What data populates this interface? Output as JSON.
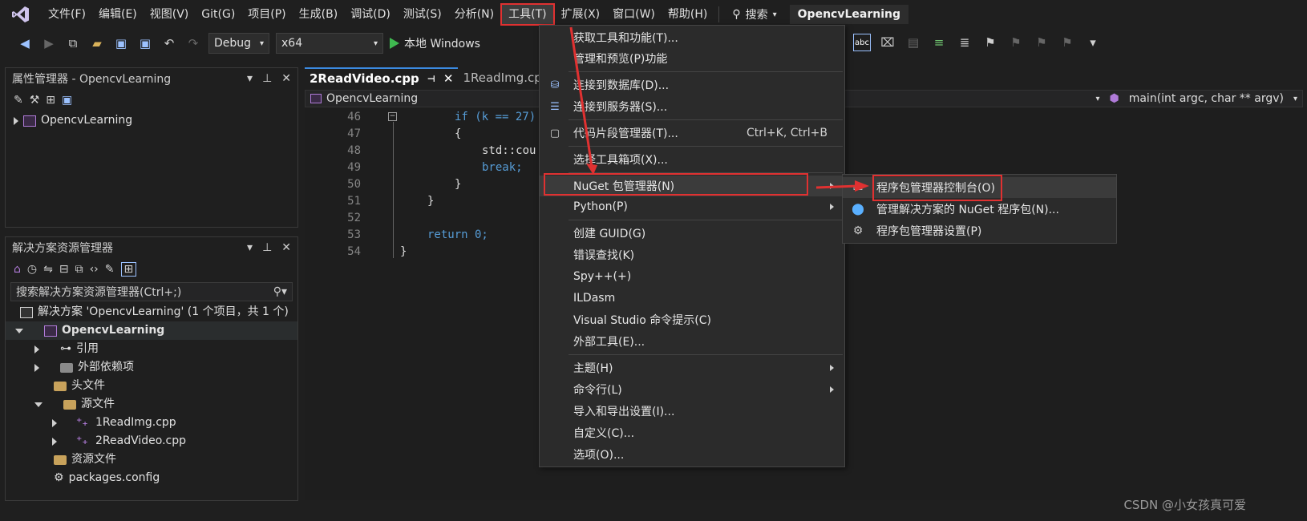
{
  "menubar": {
    "items": [
      "文件(F)",
      "编辑(E)",
      "视图(V)",
      "Git(G)",
      "项目(P)",
      "生成(B)",
      "调试(D)",
      "测试(S)",
      "分析(N)",
      "工具(T)",
      "扩展(X)",
      "窗口(W)",
      "帮助(H)"
    ],
    "search_label": "搜索",
    "project_title": "OpencvLearning"
  },
  "toolbar": {
    "config": "Debug",
    "platform": "x64",
    "run_label": "本地 Windows"
  },
  "property_manager": {
    "title": "属性管理器 - OpencvLearning",
    "items": [
      "OpencvLearning"
    ]
  },
  "solution_explorer": {
    "title": "解决方案资源管理器",
    "search_placeholder": "搜索解决方案资源管理器(Ctrl+;)",
    "solution_label": "解决方案 'OpencvLearning' (1 个项目，共 1 个)",
    "project": "OpencvLearning",
    "nodes": [
      "引用",
      "外部依赖项",
      "头文件",
      "源文件",
      "1ReadImg.cpp",
      "2ReadVideo.cpp",
      "资源文件",
      "packages.config"
    ]
  },
  "editor": {
    "tabs": [
      "2ReadVideo.cpp",
      "1ReadImg.cpp"
    ],
    "scope": "OpencvLearning",
    "function": "main(int argc, char ** argv)",
    "lines": [
      {
        "num": "46",
        "code": "if (k == 27)"
      },
      {
        "num": "47",
        "code": "{"
      },
      {
        "num": "48",
        "code": "std::cou"
      },
      {
        "num": "49",
        "code": "break;"
      },
      {
        "num": "50",
        "code": "}"
      },
      {
        "num": "51",
        "code": "}"
      },
      {
        "num": "52",
        "code": ""
      },
      {
        "num": "53",
        "code": "return 0;"
      },
      {
        "num": "54",
        "code": "}"
      }
    ]
  },
  "tools_menu": {
    "items": [
      {
        "label": "获取工具和功能(T)...",
        "shortcut": ""
      },
      {
        "label": "管理和预览(P)功能",
        "shortcut": ""
      },
      {
        "label": "连接到数据库(D)...",
        "shortcut": ""
      },
      {
        "label": "连接到服务器(S)...",
        "shortcut": ""
      },
      {
        "label": "代码片段管理器(T)...",
        "shortcut": "Ctrl+K, Ctrl+B"
      },
      {
        "label": "选择工具箱项(X)...",
        "shortcut": ""
      },
      {
        "label": "NuGet 包管理器(N)",
        "shortcut": ""
      },
      {
        "label": "Python(P)",
        "shortcut": ""
      },
      {
        "label": "创建 GUID(G)",
        "shortcut": ""
      },
      {
        "label": "错误查找(K)",
        "shortcut": ""
      },
      {
        "label": "Spy++(+)",
        "shortcut": ""
      },
      {
        "label": "ILDasm",
        "shortcut": ""
      },
      {
        "label": "Visual Studio 命令提示(C)",
        "shortcut": ""
      },
      {
        "label": "外部工具(E)...",
        "shortcut": ""
      },
      {
        "label": "主题(H)",
        "shortcut": ""
      },
      {
        "label": "命令行(L)",
        "shortcut": ""
      },
      {
        "label": "导入和导出设置(I)...",
        "shortcut": ""
      },
      {
        "label": "自定义(C)...",
        "shortcut": ""
      },
      {
        "label": "选项(O)...",
        "shortcut": ""
      }
    ]
  },
  "nuget_submenu": {
    "items": [
      "程序包管理器控制台(O)",
      "管理解决方案的 NuGet 程序包(N)...",
      "程序包管理器设置(P)"
    ]
  },
  "watermark": "CSDN @小女孩真可爱",
  "colors": {
    "highlight_red": "#e03131",
    "accent_blue": "#3b8ae0"
  }
}
